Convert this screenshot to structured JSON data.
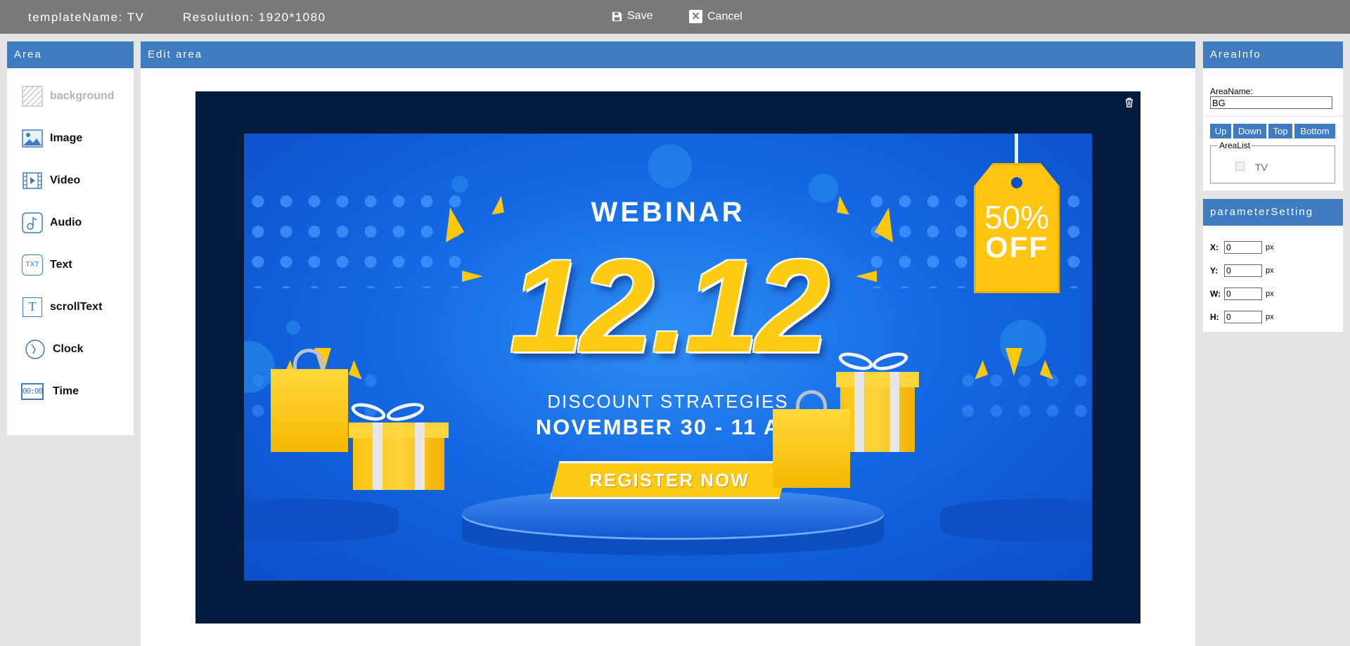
{
  "topbar": {
    "template_name_label": "templateName:",
    "template_name_value": "TV",
    "resolution_label": "Resolution:",
    "resolution_value": "1920*1080",
    "save_label": "Save",
    "cancel_label": "Cancel",
    "cancel_glyph": "✕"
  },
  "area_panel": {
    "title": "Area",
    "items": [
      {
        "label": "background",
        "icon": "background-icon"
      },
      {
        "label": "Image",
        "icon": "image-icon"
      },
      {
        "label": "Video",
        "icon": "video-icon"
      },
      {
        "label": "Audio",
        "icon": "audio-icon"
      },
      {
        "label": "Text",
        "icon": "text-icon"
      },
      {
        "label": "scrollText",
        "icon": "scroll-text-icon"
      },
      {
        "label": "Clock",
        "icon": "clock-icon"
      },
      {
        "label": "Time",
        "icon": "time-icon"
      }
    ],
    "text_icon_glyph": "TXT",
    "scroll_text_icon_glyph": "T",
    "time_icon_glyph": "00:00"
  },
  "edit_area": {
    "title": "Edit area",
    "banner": {
      "heading": "WEBINAR",
      "big_date": "12.12",
      "subtitle": "DISCOUNT STRATEGIES",
      "date_time": "NOVEMBER 30 - 11 AM",
      "cta": "REGISTER NOW",
      "tag_percent": "50%",
      "tag_off": "OFF"
    }
  },
  "area_info": {
    "title": "AreaInfo",
    "area_name_label": "AreaName:",
    "area_name_value": "BG",
    "order_buttons": {
      "up": "Up",
      "down": "Down",
      "top": "Top",
      "bottom": "Bottom"
    },
    "area_list_label": "AreaList",
    "area_list_items": [
      "TV"
    ]
  },
  "parameter_setting": {
    "title": "parameterSetting",
    "x_label": "X:",
    "x_value": "0",
    "y_label": "Y:",
    "y_value": "0",
    "w_label": "W:",
    "w_value": "0",
    "h_label": "H:",
    "h_value": "0",
    "unit": "px"
  },
  "colors": {
    "topbar_bg": "#7a7a7a",
    "panel_header": "#3e7bc1",
    "canvas_bg": "#041b40",
    "banner_blue": "#1469e4",
    "banner_yellow": "#ffcb12"
  }
}
